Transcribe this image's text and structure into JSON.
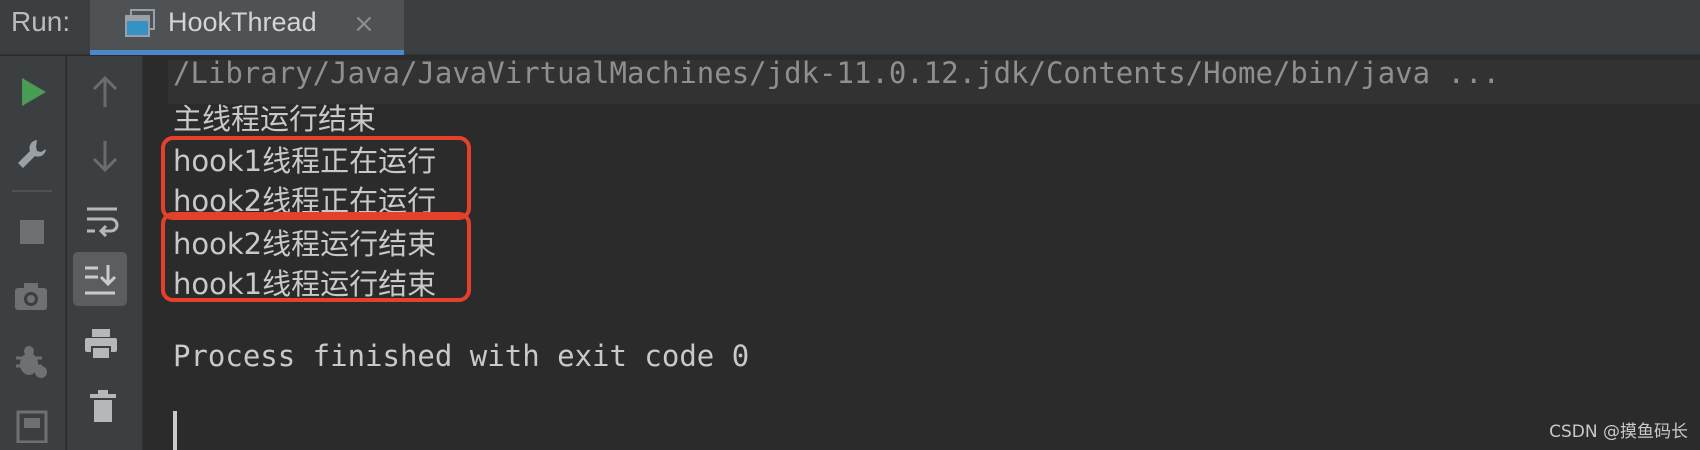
{
  "header": {
    "run_label": "Run:",
    "tab_title": "HookThread",
    "close_glyph": "×"
  },
  "toolbar_left": {
    "icons": [
      "run-icon",
      "wrench-icon",
      "stop-icon",
      "camera-icon",
      "debug-bug-icon",
      "restore-layout-icon"
    ]
  },
  "toolbar_right": {
    "icons": [
      "up-arrow-icon",
      "down-arrow-icon",
      "soft-wrap-icon",
      "scroll-to-end-icon",
      "print-icon",
      "trash-icon"
    ]
  },
  "console": {
    "command": "/Library/Java/JavaVirtualMachines/jdk-11.0.12.jdk/Contents/Home/bin/java ...",
    "lines": [
      "主线程运行结束",
      "hook1线程正在运行",
      "hook2线程正在运行",
      "hook2线程运行结束",
      "hook1线程运行结束"
    ],
    "exit_message": "Process finished with exit code 0"
  },
  "watermark": "CSDN @摸鱼码长",
  "colors": {
    "accent": "#4a88c7",
    "run_green": "#499c54",
    "highlight_box": "#e5402a"
  }
}
